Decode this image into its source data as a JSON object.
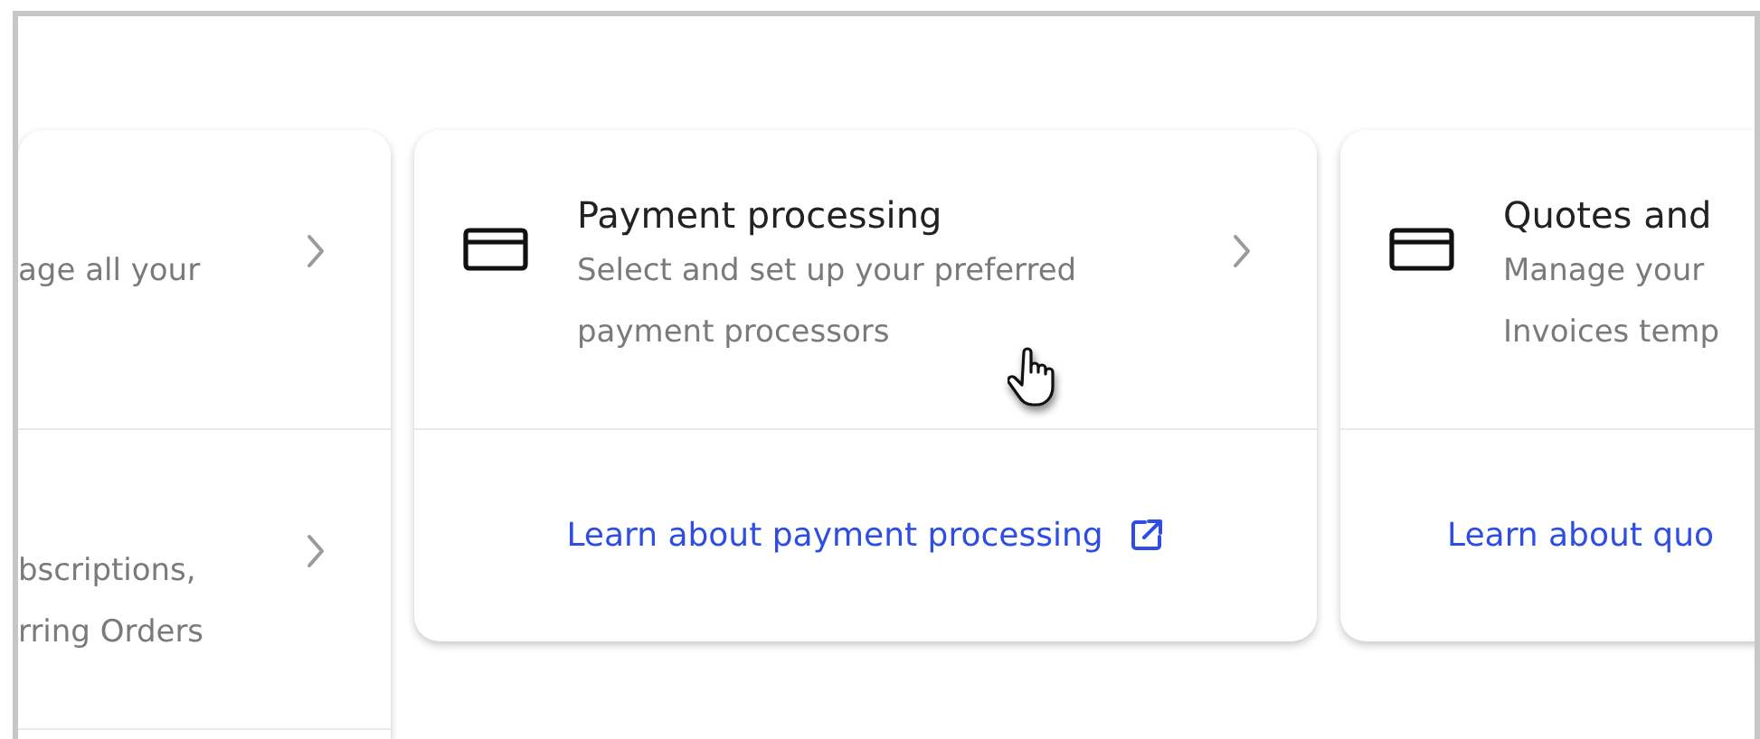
{
  "cards": [
    {
      "sections": [
        {
          "lines": [
            "age all your"
          ],
          "chevron": true
        },
        {
          "lines": [
            "bscriptions,",
            "rring Orders"
          ],
          "chevron": true
        }
      ]
    },
    {
      "sections": [
        {
          "title": "Payment processing",
          "lines": [
            "Select and set up your preferred",
            "payment processors"
          ],
          "chevron": true
        }
      ],
      "link": {
        "text": "Learn about payment processing",
        "external": true
      }
    },
    {
      "sections": [
        {
          "title": "Quotes and",
          "lines": [
            "Manage your",
            "Invoices temp"
          ],
          "chevron": false
        }
      ],
      "link": {
        "text": "Learn about quo",
        "external": false
      }
    }
  ]
}
